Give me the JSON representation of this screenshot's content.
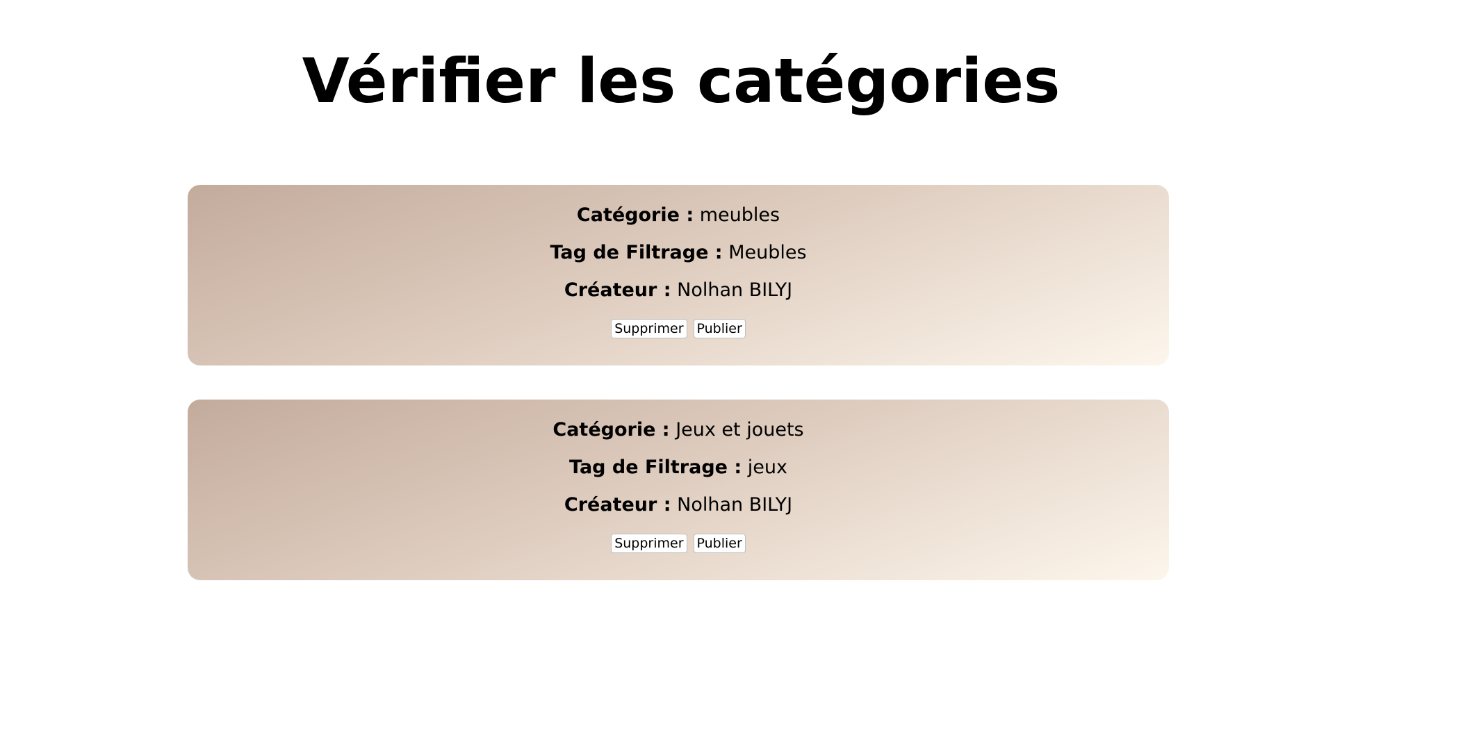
{
  "page": {
    "title": "Vérifier les catégories"
  },
  "labels": {
    "category": "Catégorie :",
    "filter_tag": "Tag de Filtrage :",
    "creator": "Créateur :",
    "delete_button": "Supprimer",
    "publish_button": "Publier"
  },
  "categories": [
    {
      "category": "meubles",
      "filter_tag": "Meubles",
      "creator": "Nolhan BILYJ"
    },
    {
      "category": "Jeux et jouets",
      "filter_tag": "jeux",
      "creator": "Nolhan BILYJ"
    }
  ],
  "colors": {
    "card_gradient_start": "#c3ab9c",
    "card_gradient_end": "#fdf6ec",
    "background": "#ffffff"
  }
}
